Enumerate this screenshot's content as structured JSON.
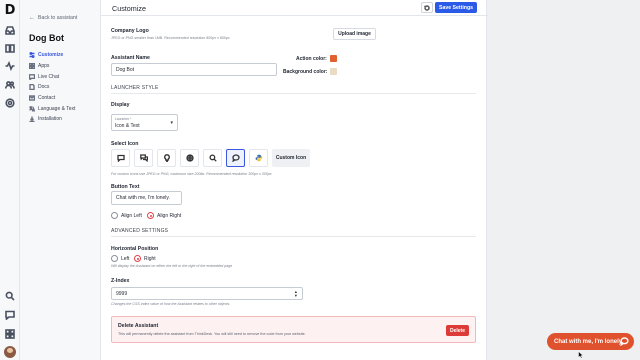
{
  "rail": {
    "logo": "D",
    "icons": [
      "inbox-icon",
      "book-icon",
      "activity-icon",
      "users-icon",
      "bot-icon",
      "search-icon",
      "chat-icon",
      "apps-icon"
    ]
  },
  "sidebar": {
    "back_label": "Back to assistant",
    "title": "Dog Bot",
    "items": [
      {
        "label": "Customize",
        "icon": "customize-icon",
        "active": true
      },
      {
        "label": "Apps",
        "icon": "apps-icon"
      },
      {
        "label": "Live Chat",
        "icon": "chat-icon"
      },
      {
        "label": "Docs",
        "icon": "doc-icon"
      },
      {
        "label": "Contact",
        "icon": "contact-icon"
      },
      {
        "label": "Language & Text",
        "icon": "language-icon"
      },
      {
        "label": "Installation",
        "icon": "install-icon"
      }
    ]
  },
  "header": {
    "title": "Customize",
    "save_label": "Save Settings"
  },
  "logo": {
    "label": "Company Logo",
    "hint": "JPEG or PNG smaller than 1MB. Recommended resolution 800px x 800px",
    "upload_label": "Upload image"
  },
  "name": {
    "label": "Assistant Name",
    "value": "Dog Bot"
  },
  "colors": {
    "action_label": "Action color:",
    "action_value": "#e0602f",
    "background_label": "Background color:",
    "background_value": "#eadcc3"
  },
  "launcher": {
    "section_title": "LAUNCHER STYLE",
    "display_label": "Display",
    "select_caption": "Launcher *",
    "select_value": "Icon & Text",
    "select_icon_label": "Select Icon",
    "icons": [
      "chat-bubble-icon",
      "chat-bubbles-icon",
      "lightbulb-icon",
      "globe-icon",
      "search-icon",
      "chat-round-icon",
      "python-icon"
    ],
    "selected_icon": "chat-round-icon",
    "custom_icon_label": "Custom Icon",
    "custom_hint": "For custom icons use JPEG or PNG, maximum size 200kb. Recommended resolution 300px x 300px",
    "button_text_label": "Button Text",
    "button_text_value": "Chat with me, I'm lonely.",
    "align_left": "Align Left",
    "align_right": "Align Right",
    "align_selected": "right"
  },
  "advanced": {
    "section_title": "ADVANCED SETTINGS",
    "horizontal_label": "Horizontal Position",
    "left_label": "Left",
    "right_label": "Right",
    "position_selected": "right",
    "position_hint": "Will display the Assistant on either the left or the right of the embedded page",
    "zindex_label": "Z-Index",
    "zindex_value": "9999",
    "zindex_hint": "Changes the CSS index value of how the Assistant relates to other objects."
  },
  "delete": {
    "title": "Delete Assistant",
    "description": "This will permanently delete the assistant from ThinkDesk. You will still need to remove the code from your website.",
    "button": "Delete"
  },
  "chat_bubble": {
    "text": "Chat with me, I'm lonely.",
    "color": "#e0522e"
  }
}
